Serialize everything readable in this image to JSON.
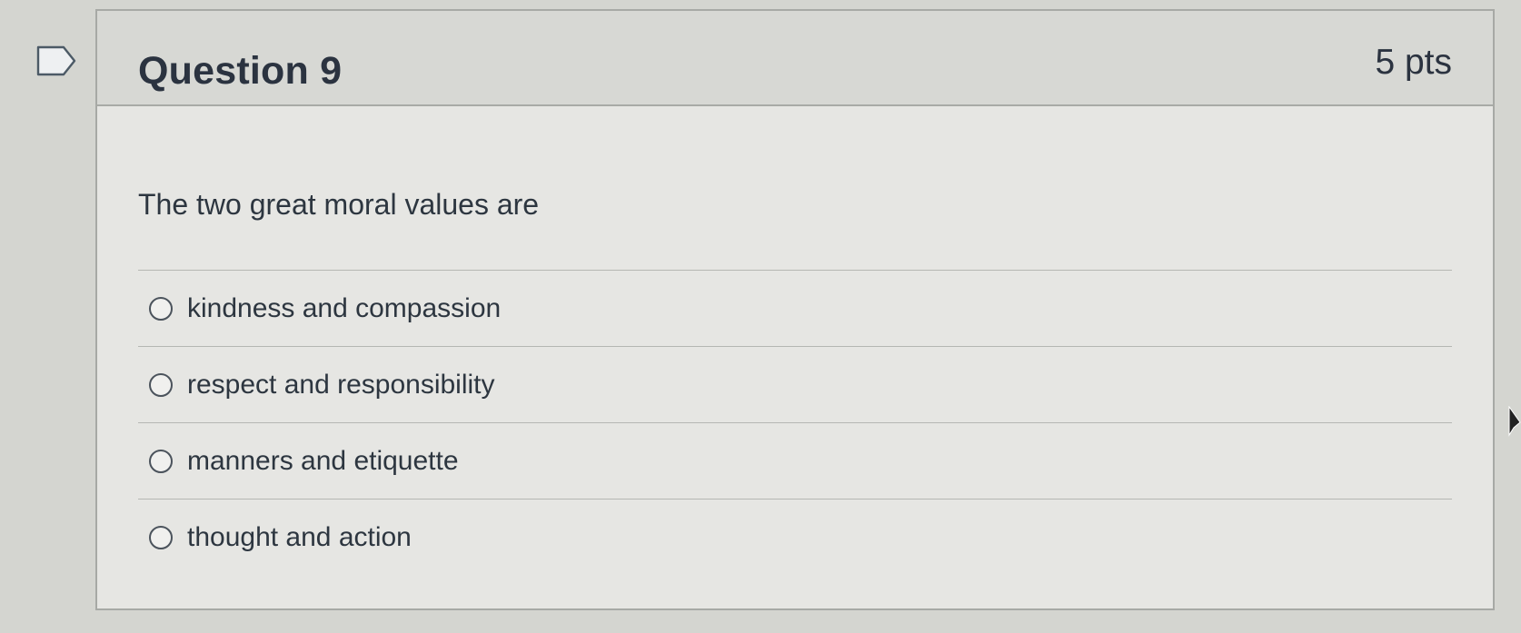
{
  "question": {
    "title": "Question 9",
    "points": "5 pts",
    "text": "The two great moral values are"
  },
  "answers": [
    {
      "label": "kindness and compassion",
      "selected": false
    },
    {
      "label": "respect and responsibility",
      "selected": false
    },
    {
      "label": "manners and etiquette",
      "selected": false
    },
    {
      "label": "thought and action",
      "selected": false
    }
  ],
  "icons": {
    "flag": "bookmark-flag-icon",
    "radio": "radio-button-icon",
    "cursor": "mouse-pointer-icon"
  },
  "colors": {
    "page_background": "#d4d5d0",
    "card_background": "#e6e6e3",
    "header_background": "#d7d8d4",
    "text": "#2d3640"
  }
}
